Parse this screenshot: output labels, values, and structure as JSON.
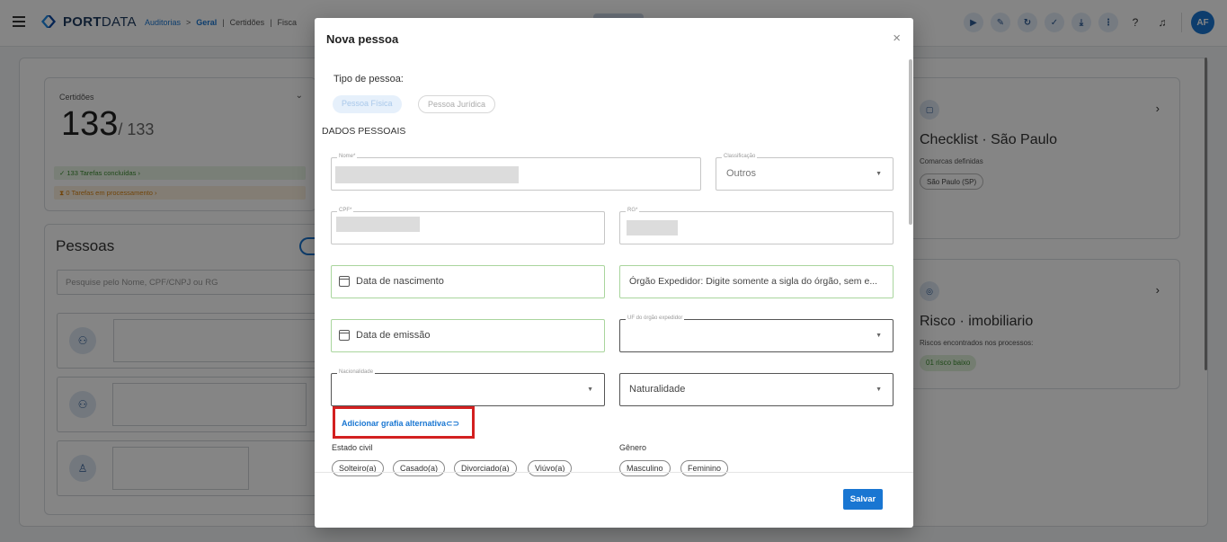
{
  "topbar": {
    "logo_bold": "PORT",
    "logo_light": "DATA",
    "breadcrumb": [
      "Auditorias",
      ">",
      "Geral",
      "|",
      "Certidões",
      "|",
      "Fisca"
    ],
    "avatar": "AF"
  },
  "certidoes": {
    "label": "Certidões",
    "count": "133",
    "total": "/ 133",
    "tasks_done": "✓ 133 Tarefas concluídas  ›",
    "tasks_processing": "⧗ 0 Tarefas em processamento  ›"
  },
  "pessoas": {
    "title": "Pessoas",
    "search_placeholder": "Pesquise pelo Nome, CPF/CNPJ ou RG"
  },
  "checklist_card": {
    "title": "Checklist · São Paulo",
    "subtitle": "Comarcas definidas",
    "chip": "São Paulo (SP)"
  },
  "risco_card": {
    "title": "Risco · imobiliario",
    "subtitle": "Riscos encontrados nos processos:",
    "chip": "01 risco baixo"
  },
  "modal": {
    "title": "Nova pessoa",
    "close": "×",
    "tipo_label": "Tipo de pessoa:",
    "tipo_fisica": "Pessoa Física",
    "tipo_juridica": "Pessoa Jurídica",
    "section_title": "DADOS PESSOAIS",
    "fields": {
      "nome_label": "Nome*",
      "classificacao_label": "Classificação",
      "classificacao_value": "Outros",
      "cpf_label": "CPF*",
      "rg_label": "RG*",
      "nascimento_placeholder": "Data de nascimento",
      "orgao_placeholder": "Órgão Expedidor: Digite somente a sigla do órgão, sem e...",
      "emissao_placeholder": "Data de emissão",
      "uf_label": "UF do órgão expedidor",
      "nacionalidade_label": "Nacionalidade",
      "naturalidade_placeholder": "Naturalidade"
    },
    "alt_link": "Adicionar grafia alternativa",
    "estado_civil_label": "Estado civil",
    "estado_civil_options": [
      "Solteiro(a)",
      "Casado(a)",
      "Divorciado(a)",
      "Viúvo(a)"
    ],
    "genero_label": "Gênero",
    "genero_options": [
      "Masculino",
      "Feminino"
    ],
    "save": "Salvar"
  }
}
